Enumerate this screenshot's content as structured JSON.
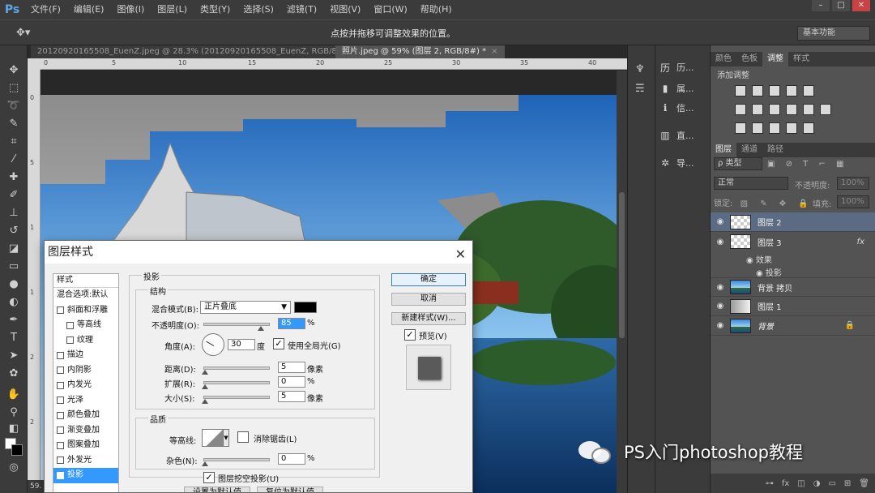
{
  "app": {
    "logo": "Ps"
  },
  "menu": [
    "文件(F)",
    "编辑(E)",
    "图像(I)",
    "图层(L)",
    "类型(Y)",
    "选择(S)",
    "滤镜(T)",
    "视图(V)",
    "窗口(W)",
    "帮助(H)"
  ],
  "options_bar": {
    "hint": "点按并拖移可调整效果的位置。",
    "workspace": "基本功能"
  },
  "tabs": [
    {
      "label": "20120920165508_EuenZ.jpeg @ 28.3% (20120920165508_EuenZ, RGB/8#)",
      "close": "×"
    },
    {
      "label": "照片.jpeg @ 59% (图层 2, RGB/8#) *",
      "close": "×"
    }
  ],
  "status": {
    "zoom": "59."
  },
  "history_panel": [
    {
      "icon": "历",
      "label": "历..."
    },
    {
      "icon": "▮",
      "label": "属..."
    },
    {
      "icon": "ℹ",
      "label": "信..."
    },
    {
      "icon": "▥",
      "label": "直..."
    },
    {
      "icon": "✲",
      "label": "导..."
    }
  ],
  "right_panel": {
    "top_tabs": [
      "颜色",
      "色板",
      "调整",
      "样式"
    ],
    "adjust_title": "添加调整",
    "layer_tabs": [
      "图层",
      "通道",
      "路径"
    ],
    "filter": "ρ 类型",
    "blend_mode": "正常",
    "opacity_label": "不透明度:",
    "opacity_value": "100%",
    "lock_label": "锁定:",
    "fill_label": "填充:",
    "fill_value": "100%",
    "layers": [
      {
        "name": "图层 2",
        "thumb": "trans",
        "selected": true
      },
      {
        "name": "图层 3",
        "thumb": "trans",
        "fx": "fx"
      },
      {
        "name": "背景 拷贝",
        "thumb": "photo"
      },
      {
        "name": "图层 1",
        "thumb": "grad"
      },
      {
        "name": "背景",
        "thumb": "photo",
        "lock": "🔒"
      }
    ],
    "effects": {
      "label": "效果",
      "item": "投影"
    }
  },
  "dialog": {
    "title": "图层样式",
    "close": "✕",
    "styles_header": "样式",
    "styles": [
      {
        "label": "混合选项:默认",
        "checkbox": false,
        "indent": false
      },
      {
        "label": "斜面和浮雕",
        "checkbox": true,
        "indent": false
      },
      {
        "label": "等高线",
        "checkbox": true,
        "indent": true
      },
      {
        "label": "纹理",
        "checkbox": true,
        "indent": true
      },
      {
        "label": "描边",
        "checkbox": true,
        "indent": false
      },
      {
        "label": "内阴影",
        "checkbox": true,
        "indent": false
      },
      {
        "label": "内发光",
        "checkbox": true,
        "indent": false
      },
      {
        "label": "光泽",
        "checkbox": true,
        "indent": false
      },
      {
        "label": "颜色叠加",
        "checkbox": true,
        "indent": false
      },
      {
        "label": "渐变叠加",
        "checkbox": true,
        "indent": false
      },
      {
        "label": "图案叠加",
        "checkbox": true,
        "indent": false
      },
      {
        "label": "外发光",
        "checkbox": true,
        "indent": false
      },
      {
        "label": "投影",
        "checkbox": true,
        "indent": false,
        "selected": true,
        "checked": true
      }
    ],
    "section_title": "投影",
    "structure": {
      "legend": "结构",
      "blend_label": "混合模式(B):",
      "blend_value": "正片叠底",
      "shadow_color": "#000000",
      "opacity_label": "不透明度(O):",
      "opacity_value": "85",
      "angle_label": "角度(A):",
      "angle_value": "30",
      "angle_unit": "度",
      "global_light": "使用全局光(G)",
      "distance_label": "距离(D):",
      "distance_value": "5",
      "distance_unit": "像素",
      "spread_label": "扩展(R):",
      "spread_value": "0",
      "size_label": "大小(S):",
      "size_value": "5",
      "size_unit": "像素",
      "percent": "%"
    },
    "quality": {
      "legend": "品质",
      "contour_label": "等高线:",
      "antialias": "消除锯齿(L)",
      "noise_label": "杂色(N):",
      "noise_value": "0",
      "percent": "%"
    },
    "layer_knocks_out": "图层挖空投影(U)",
    "set_default": "设置为默认值",
    "reset_default": "复位为默认值",
    "buttons": {
      "ok": "确定",
      "cancel": "取消",
      "new_style": "新建样式(W)...",
      "preview": "预览(V)"
    }
  },
  "watermark": "PS入门photoshop教程"
}
